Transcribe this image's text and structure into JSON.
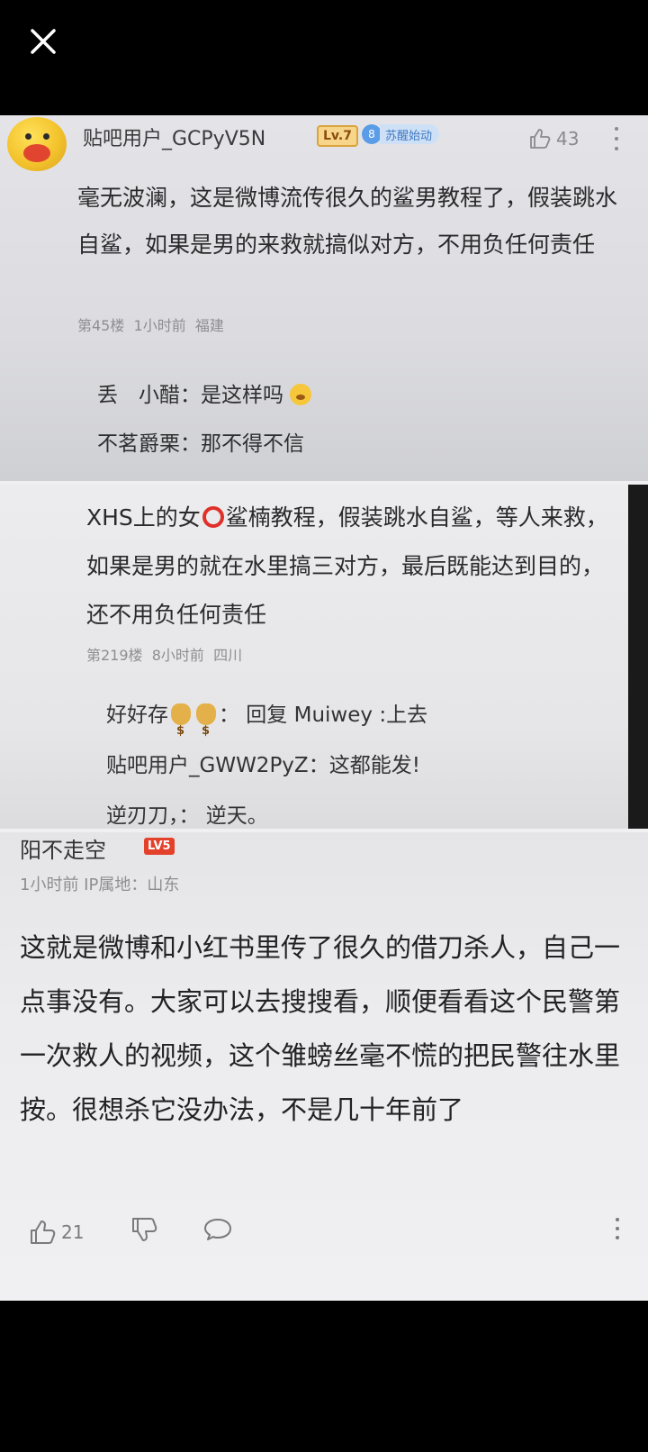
{
  "viewer": {
    "close_icon": "close-icon"
  },
  "post1": {
    "username": "贴吧用户_GCPyV5N",
    "level": "Lv.7",
    "badge_icon_text": "8",
    "badge_text": "苏醒始动",
    "like_count": "43",
    "body": "毫无波澜，这是微博流传很久的鲨男教程了，假装跳水自鲨，如果是男的来救就搞似对方，不用负任何责任",
    "floor": "第45楼",
    "time": "1小时前",
    "location": "福建",
    "replies": [
      {
        "name": "丢　小醋",
        "text": "：是这样吗"
      },
      {
        "name": "不茗爵栗",
        "text": "：那不得不信"
      }
    ]
  },
  "post2": {
    "body_prefix": "XHS上的女",
    "body_rest": "鲨楠教程，假装跳水自鲨，等人来救，如果是男的就在水里搞三对方，最后既能达到目的，还不用负任何责任",
    "floor": "第219楼",
    "time": "8小时前",
    "location": "四川",
    "replies": [
      {
        "name": "好好存",
        "text": "： 回复 Muiwey :上去"
      },
      {
        "name": "贴吧用户_GWW2PyZ",
        "text": "：这都能发!"
      },
      {
        "name": "逆刃刀，",
        "text": "： 逆天。"
      }
    ]
  },
  "post3": {
    "username": "阳不走空",
    "level": "LV5",
    "meta": "1小时前  IP属地：山东",
    "body": "这就是微博和小红书里传了很久的借刀杀人，自己一点事没有。大家可以去搜搜看，顺便看看这个民警第一次救人的视频，这个雏螃丝毫不慌的把民警往水里按。很想杀它没办法，不是几十年前了",
    "like_count": "21"
  }
}
